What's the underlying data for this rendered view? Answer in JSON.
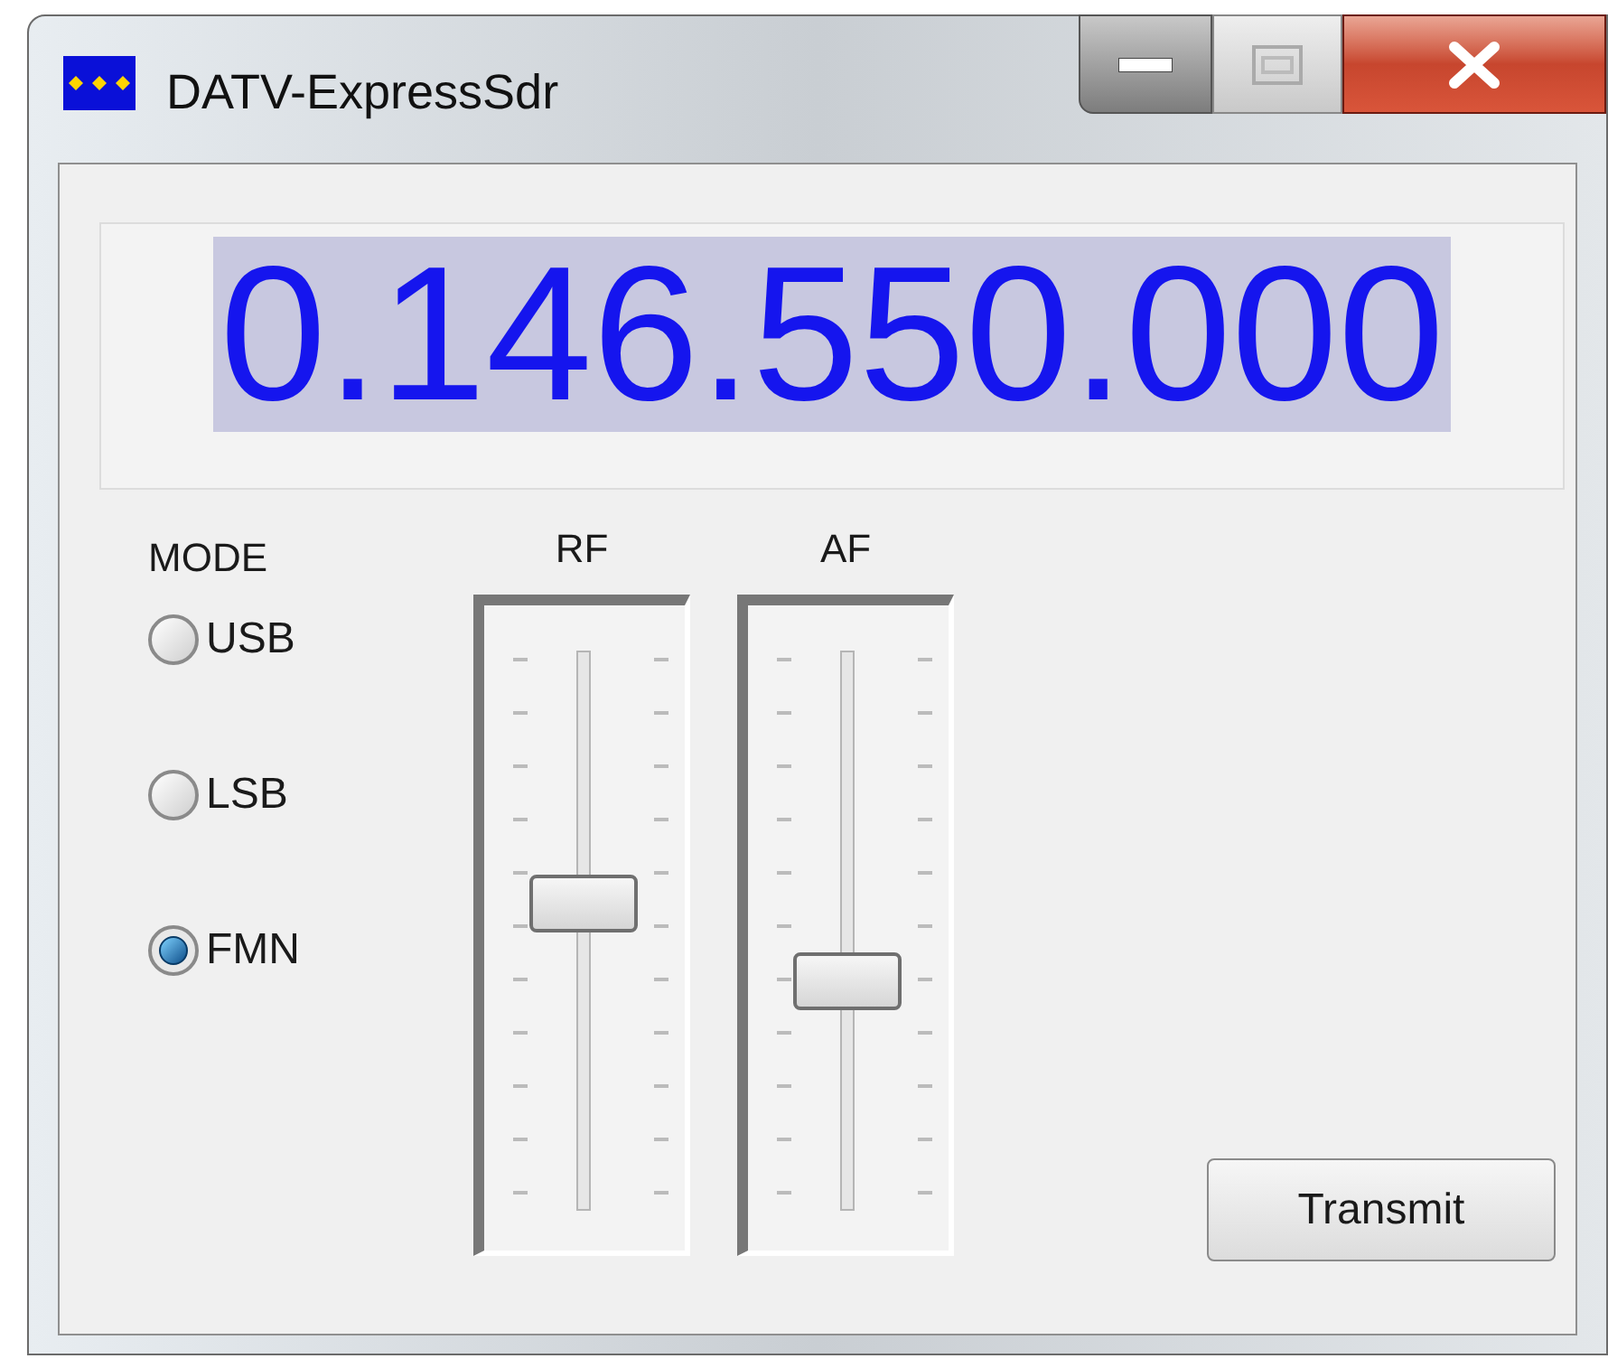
{
  "window": {
    "title": "DATV-ExpressSdr"
  },
  "frequency": {
    "value": "0.146.550.000"
  },
  "mode": {
    "label": "MODE",
    "options": [
      {
        "label": "USB",
        "selected": false
      },
      {
        "label": "LSB",
        "selected": false
      },
      {
        "label": "FMN",
        "selected": true
      }
    ]
  },
  "sliders": [
    {
      "label": "RF",
      "level": 0.55
    },
    {
      "label": "AF",
      "level": 0.41
    }
  ],
  "buttons": [
    "Transmit"
  ]
}
